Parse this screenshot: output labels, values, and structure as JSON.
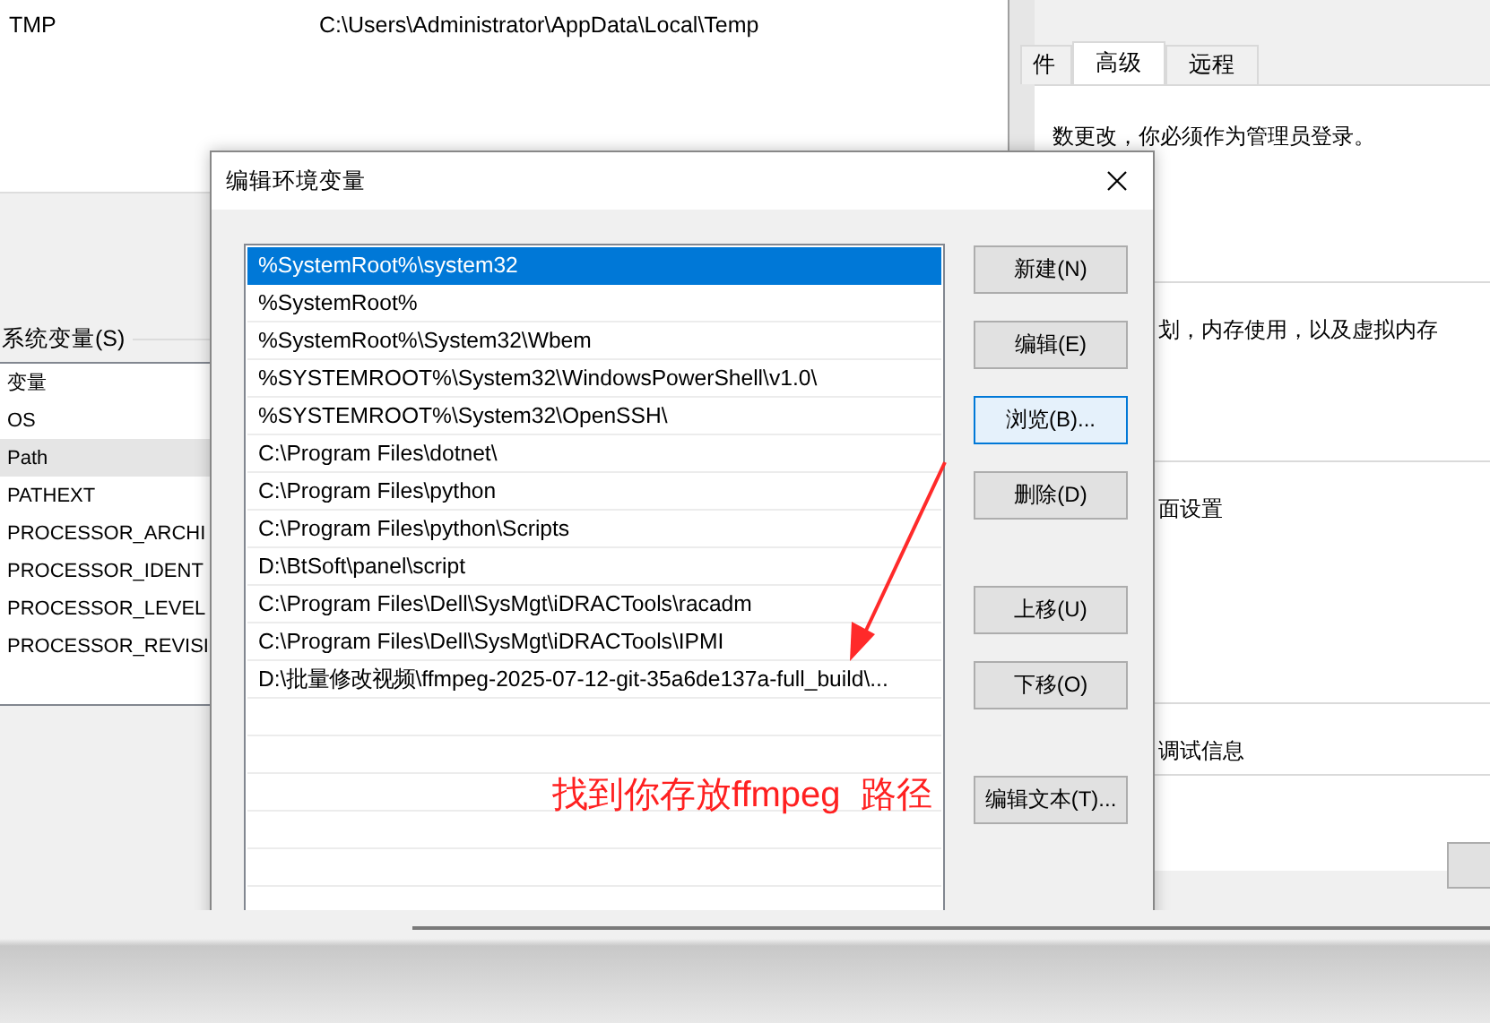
{
  "env_window": {
    "user_vars": [
      {
        "name": "TMP",
        "value": "C:\\Users\\Administrator\\AppData\\Local\\Temp"
      }
    ],
    "system_vars_label": "系统变量(S)",
    "system_vars": {
      "header": "变量",
      "rows": [
        {
          "name": "OS",
          "selected": false
        },
        {
          "name": "Path",
          "selected": true
        },
        {
          "name": "PATHEXT",
          "selected": false
        },
        {
          "name": "PROCESSOR_ARCHI",
          "selected": false
        },
        {
          "name": "PROCESSOR_IDENT",
          "selected": false
        },
        {
          "name": "PROCESSOR_LEVEL",
          "selected": false
        },
        {
          "name": "PROCESSOR_REVISI",
          "selected": false
        }
      ]
    }
  },
  "system_properties": {
    "tabs": [
      {
        "label": "件",
        "selected": false
      },
      {
        "label": "高级",
        "selected": true
      },
      {
        "label": "远程",
        "selected": false
      }
    ],
    "texts": [
      "数更改，你必须作为管理员登录。",
      "划，内存使用，以及虚拟内存",
      "面设置",
      "调试信息"
    ]
  },
  "dialog": {
    "title": "编辑环境变量",
    "paths": [
      {
        "text": "%SystemRoot%\\system32",
        "selected": true
      },
      {
        "text": "%SystemRoot%",
        "selected": false
      },
      {
        "text": "%SystemRoot%\\System32\\Wbem",
        "selected": false
      },
      {
        "text": "%SYSTEMROOT%\\System32\\WindowsPowerShell\\v1.0\\",
        "selected": false
      },
      {
        "text": "%SYSTEMROOT%\\System32\\OpenSSH\\",
        "selected": false
      },
      {
        "text": "C:\\Program Files\\dotnet\\",
        "selected": false
      },
      {
        "text": "C:\\Program Files\\python",
        "selected": false
      },
      {
        "text": "C:\\Program Files\\python\\Scripts",
        "selected": false
      },
      {
        "text": "D:\\BtSoft\\panel\\script",
        "selected": false
      },
      {
        "text": "C:\\Program Files\\Dell\\SysMgt\\iDRACTools\\racadm",
        "selected": false
      },
      {
        "text": "C:\\Program Files\\Dell\\SysMgt\\iDRACTools\\IPMI",
        "selected": false
      },
      {
        "text": "D:\\批量修改视频\\ffmpeg-2025-07-12-git-35a6de137a-full_build\\...",
        "selected": false
      }
    ],
    "button_groups": [
      [
        {
          "label": "新建(N)",
          "focused": false
        },
        {
          "label": "编辑(E)",
          "focused": false
        },
        {
          "label": "浏览(B)...",
          "focused": true
        },
        {
          "label": "删除(D)",
          "focused": false
        }
      ],
      [
        {
          "label": "上移(U)",
          "focused": false
        },
        {
          "label": "下移(O)",
          "focused": false
        }
      ],
      [
        {
          "label": "编辑文本(T)...",
          "focused": false
        }
      ]
    ]
  },
  "annotation": {
    "text": "找到你存放ffmpeg  路径"
  }
}
